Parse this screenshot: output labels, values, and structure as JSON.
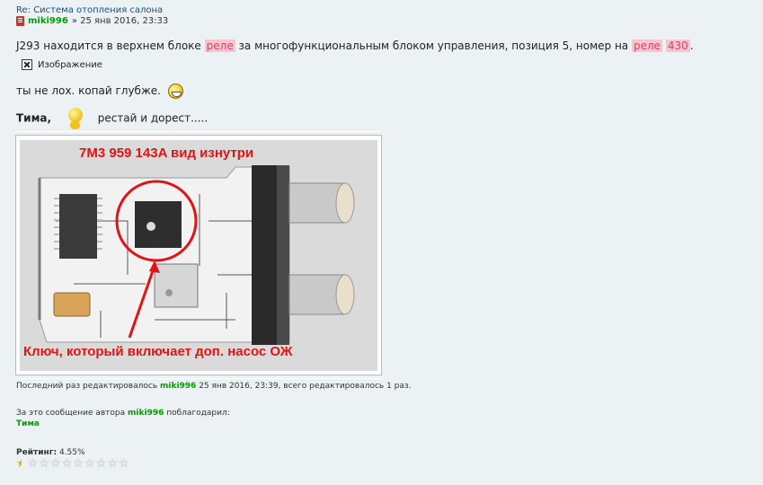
{
  "post": {
    "title": "Re: Система отопления салона",
    "author": "miki996",
    "date": "» 25 янв 2016, 23:33",
    "line1_prefix": "J293 находится в верхнем блоке",
    "line1_hl1": "реле",
    "line1_mid": "за многофункциональным блоком управления, позиция 5, номер на",
    "line1_hl2": "реле",
    "line1_hl3": "430",
    "line1_end": ".",
    "image_placeholder": "Изображение",
    "line2": "ты не лох. копай глубже.",
    "line3_name": "Тима,",
    "line3_rest": "рестай и дорест.....",
    "photo_title": "7M3 959 143A  вид изнутри",
    "photo_caption": "Ключ, который включает доп. насос ОЖ"
  },
  "edit": {
    "prefix": "Последний раз редактировалось",
    "user": "miki996",
    "suffix": "25 янв 2016, 23:39, всего редактировалось 1 раз."
  },
  "thanks": {
    "label": "За это сообщение автора",
    "author": "miki996",
    "suffix": "поблагодарил:",
    "user": "Тима"
  },
  "rating": {
    "label": "Рейтинг:",
    "value": "4.55%",
    "stars_total": 10,
    "stars_filled": 0.5
  },
  "colors": {
    "background": "#ECF1F3",
    "username": "#00A000",
    "highlight_bg": "#f6c6cf",
    "highlight_fg": "#d2456a",
    "photo_text": "#e01414"
  }
}
